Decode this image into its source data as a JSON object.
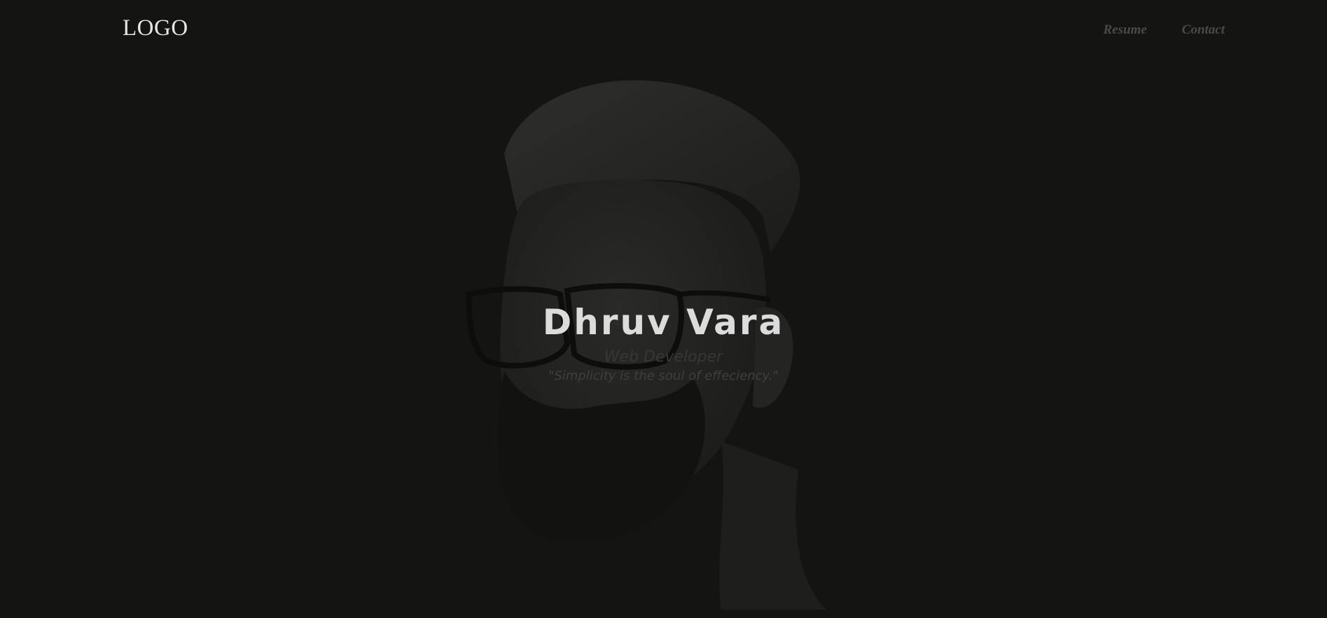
{
  "header": {
    "logo": "LOGO",
    "nav": [
      {
        "label": "Resume"
      },
      {
        "label": "Contact"
      }
    ]
  },
  "hero": {
    "name": "Dhruv Vara",
    "role": "Web Developer",
    "quote": "\"Simplicity is the soul of effeciency.\""
  },
  "colors": {
    "background": "#141412",
    "name_text": "#dcdcdc",
    "nav_text": "#4a4a48",
    "subtext": "#373735"
  },
  "icons": {
    "portrait": "bearded-man-portrait-illustration"
  }
}
